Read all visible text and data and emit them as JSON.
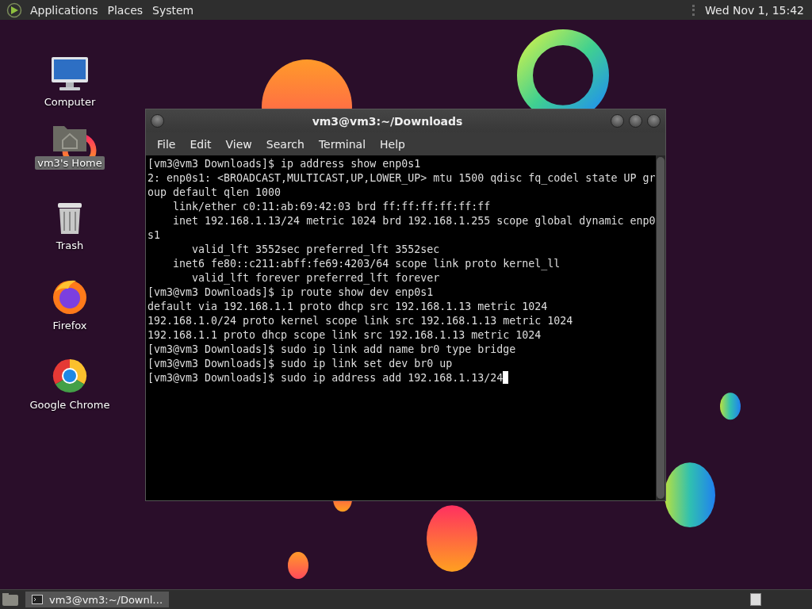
{
  "top_panel": {
    "menus": [
      "Applications",
      "Places",
      "System"
    ],
    "clock": "Wed Nov 1, 15:42"
  },
  "desktop": {
    "icons": [
      {
        "label": "Computer",
        "kind": "computer",
        "selected": false
      },
      {
        "label": "vm3's Home",
        "kind": "home",
        "selected": true
      },
      {
        "label": "Trash",
        "kind": "trash",
        "selected": false
      },
      {
        "label": "Firefox",
        "kind": "firefox",
        "selected": false
      },
      {
        "label": "Google Chrome",
        "kind": "chrome",
        "selected": false
      }
    ]
  },
  "window": {
    "title": "vm3@vm3:~/Downloads",
    "menu": [
      "File",
      "Edit",
      "View",
      "Search",
      "Terminal",
      "Help"
    ],
    "terminal": {
      "cursor": true,
      "lines": [
        "[vm3@vm3 Downloads]$ ip address show enp0s1",
        "2: enp0s1: <BROADCAST,MULTICAST,UP,LOWER_UP> mtu 1500 qdisc fq_codel state UP gr",
        "oup default qlen 1000",
        "    link/ether c0:11:ab:69:42:03 brd ff:ff:ff:ff:ff:ff",
        "    inet 192.168.1.13/24 metric 1024 brd 192.168.1.255 scope global dynamic enp0",
        "s1",
        "       valid_lft 3552sec preferred_lft 3552sec",
        "    inet6 fe80::c211:abff:fe69:4203/64 scope link proto kernel_ll",
        "       valid_lft forever preferred_lft forever",
        "[vm3@vm3 Downloads]$ ip route show dev enp0s1",
        "default via 192.168.1.1 proto dhcp src 192.168.1.13 metric 1024",
        "192.168.1.0/24 proto kernel scope link src 192.168.1.13 metric 1024",
        "192.168.1.1 proto dhcp scope link src 192.168.1.13 metric 1024",
        "[vm3@vm3 Downloads]$ sudo ip link add name br0 type bridge",
        "[vm3@vm3 Downloads]$ sudo ip link set dev br0 up",
        "[vm3@vm3 Downloads]$ sudo ip address add 192.168.1.13/24"
      ]
    }
  },
  "taskbar": {
    "tasks": [
      {
        "label": "vm3@vm3:~/Downl…",
        "selected": true
      }
    ]
  }
}
